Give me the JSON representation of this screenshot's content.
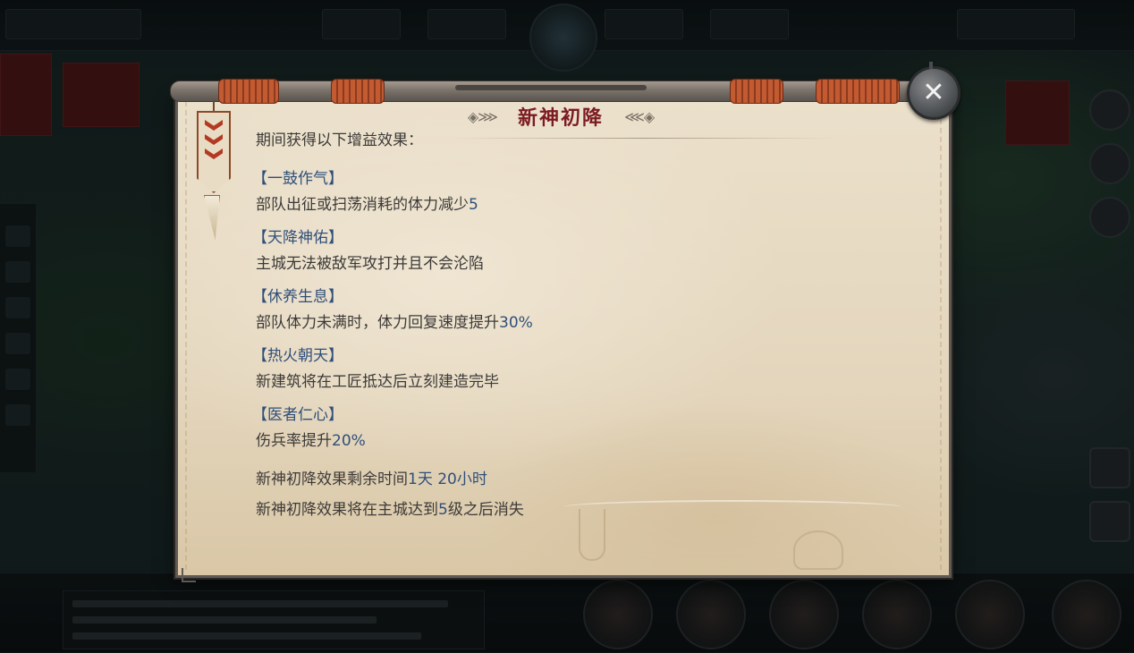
{
  "dialog": {
    "title": "新神初降",
    "title_ornament_left": "◈⋙",
    "title_ornament_right": "⋘◈",
    "clipped_intro": "期间获得以下增益效果：",
    "close_label": "✕"
  },
  "buffs": [
    {
      "name": "【一鼓作气】",
      "desc_pre": "部队出征或扫荡消耗的体力减少",
      "desc_value": "5",
      "desc_post": ""
    },
    {
      "name": "【天降神佑】",
      "desc_pre": "主城无法被敌军攻打并且不会沦陷",
      "desc_value": "",
      "desc_post": ""
    },
    {
      "name": "【休养生息】",
      "desc_pre": "部队体力未满时，体力回复速度提升",
      "desc_value": "30%",
      "desc_post": ""
    },
    {
      "name": "【热火朝天】",
      "desc_pre": "新建筑将在工匠抵达后立刻建造完毕",
      "desc_value": "",
      "desc_post": ""
    },
    {
      "name": "【医者仁心】",
      "desc_pre": "伤兵率提升",
      "desc_value": "20%",
      "desc_post": ""
    }
  ],
  "footer": {
    "remaining_label": "新神初降效果剩余时间",
    "remaining_value": "1天 20小时",
    "expire_pre": "新神初降效果将在主城达到",
    "expire_value": "5",
    "expire_post": "级之后消失"
  },
  "colors": {
    "title": "#7c1c22",
    "buff_name": "#2f4f7a",
    "body_text": "#3c3a38",
    "parchment": "#e8dcc5"
  },
  "icons": {
    "close": "close-icon",
    "pennant": "pennant-icon",
    "fang": "fang-icon"
  }
}
